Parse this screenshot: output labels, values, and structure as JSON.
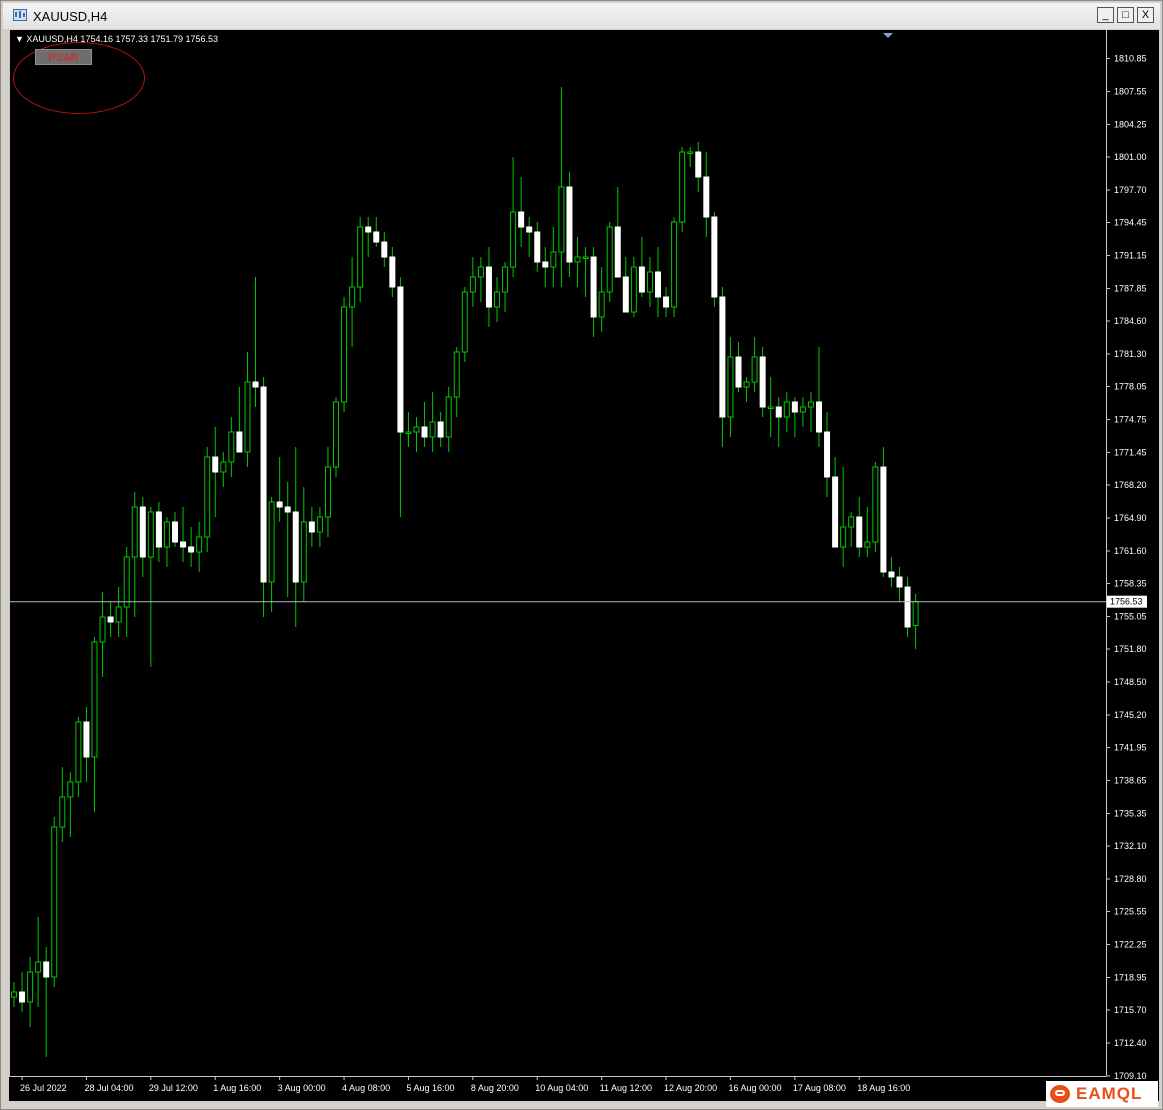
{
  "window": {
    "title": "XAUUSD,H4",
    "minimize_label": "_",
    "maximize_label": "□",
    "close_label": "X"
  },
  "chart_header": {
    "text": "XAUUSD,H4  1754.16 1757.33 1751.79 1756.53"
  },
  "indicator_button": {
    "label": "PSAR"
  },
  "watermark": {
    "text": "EAMQL"
  },
  "colors": {
    "background": "#000000",
    "bull_body": "#000000",
    "bull_outline": "#00c800",
    "bear_body": "#ffffff",
    "wick": "#00c800",
    "price_line": "#b4bcc8",
    "highlight_circle": "#b01818"
  },
  "chart_data": {
    "type": "candlestick",
    "symbol": "XAUUSD",
    "timeframe": "H4",
    "ylim": [
      1709.1,
      1812.5
    ],
    "current_price": 1756.53,
    "current_price_label": "1756.53",
    "yticks": [
      "1810.85",
      "1807.55",
      "1804.25",
      "1801.00",
      "1797.70",
      "1794.45",
      "1791.15",
      "1787.85",
      "1784.60",
      "1781.30",
      "1778.05",
      "1774.75",
      "1771.45",
      "1768.20",
      "1764.90",
      "1761.60",
      "1758.35",
      "1755.05",
      "1751.80",
      "1748.50",
      "1745.20",
      "1741.95",
      "1738.65",
      "1735.35",
      "1732.10",
      "1728.80",
      "1725.55",
      "1722.25",
      "1718.95",
      "1715.70",
      "1712.40",
      "1709.10"
    ],
    "xticks": [
      {
        "label": "26 Jul 2022",
        "index": 1
      },
      {
        "label": "28 Jul 04:00",
        "index": 9
      },
      {
        "label": "29 Jul 12:00",
        "index": 17
      },
      {
        "label": "1 Aug 16:00",
        "index": 25
      },
      {
        "label": "3 Aug 00:00",
        "index": 33
      },
      {
        "label": "4 Aug 08:00",
        "index": 41
      },
      {
        "label": "5 Aug 16:00",
        "index": 49
      },
      {
        "label": "8 Aug 20:00",
        "index": 57
      },
      {
        "label": "10 Aug 04:00",
        "index": 65
      },
      {
        "label": "11 Aug 12:00",
        "index": 73
      },
      {
        "label": "12 Aug 20:00",
        "index": 81
      },
      {
        "label": "16 Aug 00:00",
        "index": 89
      },
      {
        "label": "17 Aug 08:00",
        "index": 97
      },
      {
        "label": "18 Aug 16:00",
        "index": 105
      }
    ],
    "ohlc": [
      [
        1717.0,
        1718.5,
        1716.0,
        1717.5
      ],
      [
        1717.5,
        1719.5,
        1715.5,
        1716.5
      ],
      [
        1716.5,
        1721.0,
        1714.0,
        1719.5
      ],
      [
        1719.5,
        1725.0,
        1716.0,
        1720.5
      ],
      [
        1720.5,
        1722.0,
        1711.0,
        1719.0
      ],
      [
        1719.0,
        1735.0,
        1718.0,
        1734.0
      ],
      [
        1734.0,
        1740.0,
        1732.5,
        1737.0
      ],
      [
        1737.0,
        1739.5,
        1733.0,
        1738.5
      ],
      [
        1738.5,
        1745.0,
        1737.0,
        1744.5
      ],
      [
        1744.5,
        1746.0,
        1738.5,
        1741.0
      ],
      [
        1741.0,
        1753.0,
        1735.5,
        1752.5
      ],
      [
        1752.5,
        1757.5,
        1749.0,
        1755.0
      ],
      [
        1755.0,
        1756.5,
        1753.0,
        1754.5
      ],
      [
        1754.5,
        1758.0,
        1753.0,
        1756.0
      ],
      [
        1756.0,
        1762.0,
        1753.0,
        1761.0
      ],
      [
        1761.0,
        1767.5,
        1755.0,
        1766.0
      ],
      [
        1766.0,
        1767.0,
        1759.0,
        1761.0
      ],
      [
        1761.0,
        1766.0,
        1750.0,
        1765.5
      ],
      [
        1765.5,
        1766.5,
        1760.5,
        1762.0
      ],
      [
        1762.0,
        1765.0,
        1760.0,
        1764.5
      ],
      [
        1764.5,
        1765.5,
        1762.0,
        1762.5
      ],
      [
        1762.5,
        1766.0,
        1760.5,
        1762.0
      ],
      [
        1762.0,
        1764.0,
        1760.0,
        1761.5
      ],
      [
        1761.5,
        1764.5,
        1759.5,
        1763.0
      ],
      [
        1763.0,
        1772.0,
        1761.5,
        1771.0
      ],
      [
        1771.0,
        1774.0,
        1765.0,
        1769.5
      ],
      [
        1769.5,
        1771.5,
        1768.0,
        1770.5
      ],
      [
        1770.5,
        1775.0,
        1769.0,
        1773.5
      ],
      [
        1773.5,
        1778.0,
        1771.5,
        1771.5
      ],
      [
        1771.5,
        1781.5,
        1770.0,
        1778.5
      ],
      [
        1778.5,
        1789.0,
        1776.0,
        1778.0
      ],
      [
        1778.0,
        1779.0,
        1755.0,
        1758.5
      ],
      [
        1758.5,
        1767.0,
        1755.5,
        1766.5
      ],
      [
        1766.5,
        1771.0,
        1764.5,
        1766.0
      ],
      [
        1766.0,
        1768.5,
        1757.0,
        1765.5
      ],
      [
        1765.5,
        1772.0,
        1754.0,
        1758.5
      ],
      [
        1758.5,
        1768.0,
        1756.5,
        1764.5
      ],
      [
        1764.5,
        1766.0,
        1762.0,
        1763.5
      ],
      [
        1763.5,
        1766.0,
        1762.0,
        1765.0
      ],
      [
        1765.0,
        1772.0,
        1763.0,
        1770.0
      ],
      [
        1770.0,
        1777.0,
        1769.0,
        1776.5
      ],
      [
        1776.5,
        1787.0,
        1775.5,
        1786.0
      ],
      [
        1786.0,
        1791.0,
        1782.0,
        1788.0
      ],
      [
        1788.0,
        1795.0,
        1786.5,
        1794.0
      ],
      [
        1794.0,
        1795.0,
        1791.0,
        1793.5
      ],
      [
        1793.5,
        1795.0,
        1792.0,
        1792.5
      ],
      [
        1792.5,
        1793.5,
        1790.0,
        1791.0
      ],
      [
        1791.0,
        1792.0,
        1787.0,
        1788.0
      ],
      [
        1788.0,
        1789.0,
        1765.0,
        1773.5
      ],
      [
        1773.5,
        1775.5,
        1772.0,
        1773.5
      ],
      [
        1773.5,
        1775.0,
        1771.5,
        1774.0
      ],
      [
        1774.0,
        1776.5,
        1772.0,
        1773.0
      ],
      [
        1773.0,
        1777.5,
        1771.5,
        1774.5
      ],
      [
        1774.5,
        1775.5,
        1772.0,
        1773.0
      ],
      [
        1773.0,
        1778.0,
        1771.5,
        1777.0
      ],
      [
        1777.0,
        1782.0,
        1775.0,
        1781.5
      ],
      [
        1781.5,
        1788.0,
        1780.5,
        1787.5
      ],
      [
        1787.5,
        1791.0,
        1786.0,
        1789.0
      ],
      [
        1789.0,
        1791.0,
        1786.5,
        1790.0
      ],
      [
        1790.0,
        1792.0,
        1784.0,
        1786.0
      ],
      [
        1786.0,
        1789.0,
        1784.5,
        1787.5
      ],
      [
        1787.5,
        1790.5,
        1785.5,
        1790.0
      ],
      [
        1790.0,
        1801.0,
        1789.0,
        1795.5
      ],
      [
        1795.5,
        1799.0,
        1792.0,
        1794.0
      ],
      [
        1794.0,
        1795.0,
        1791.0,
        1793.5
      ],
      [
        1793.5,
        1794.5,
        1789.5,
        1790.5
      ],
      [
        1790.5,
        1792.0,
        1788.0,
        1790.0
      ],
      [
        1790.0,
        1794.0,
        1788.0,
        1791.5
      ],
      [
        1791.5,
        1808.0,
        1788.0,
        1798.0
      ],
      [
        1798.0,
        1799.5,
        1789.0,
        1790.5
      ],
      [
        1790.5,
        1793.0,
        1788.0,
        1791.0
      ],
      [
        1791.0,
        1792.0,
        1787.0,
        1791.0
      ],
      [
        1791.0,
        1792.0,
        1783.0,
        1785.0
      ],
      [
        1785.0,
        1790.0,
        1783.5,
        1787.5
      ],
      [
        1787.5,
        1794.5,
        1786.5,
        1794.0
      ],
      [
        1794.0,
        1798.0,
        1789.5,
        1789.0
      ],
      [
        1789.0,
        1791.0,
        1785.5,
        1785.5
      ],
      [
        1785.5,
        1791.0,
        1785.0,
        1790.0
      ],
      [
        1790.0,
        1793.0,
        1787.0,
        1787.5
      ],
      [
        1787.5,
        1791.0,
        1786.0,
        1789.5
      ],
      [
        1789.5,
        1792.0,
        1785.0,
        1787.0
      ],
      [
        1787.0,
        1788.0,
        1785.0,
        1786.0
      ],
      [
        1786.0,
        1795.0,
        1785.0,
        1794.5
      ],
      [
        1794.5,
        1802.0,
        1793.5,
        1801.5
      ],
      [
        1801.5,
        1802.0,
        1800.0,
        1801.5
      ],
      [
        1801.5,
        1802.5,
        1797.5,
        1799.0
      ],
      [
        1799.0,
        1801.5,
        1793.0,
        1795.0
      ],
      [
        1795.0,
        1795.5,
        1786.0,
        1787.0
      ],
      [
        1787.0,
        1788.0,
        1772.0,
        1775.0
      ],
      [
        1775.0,
        1783.0,
        1773.0,
        1781.0
      ],
      [
        1781.0,
        1782.5,
        1777.5,
        1778.0
      ],
      [
        1778.0,
        1779.0,
        1776.5,
        1778.5
      ],
      [
        1778.5,
        1783.0,
        1777.5,
        1781.0
      ],
      [
        1781.0,
        1782.0,
        1775.0,
        1776.0
      ],
      [
        1776.0,
        1779.0,
        1773.0,
        1776.0
      ],
      [
        1776.0,
        1777.0,
        1772.0,
        1775.0
      ],
      [
        1775.0,
        1777.5,
        1773.5,
        1776.5
      ],
      [
        1776.5,
        1777.0,
        1773.0,
        1775.5
      ],
      [
        1775.5,
        1777.0,
        1774.0,
        1776.0
      ],
      [
        1776.0,
        1777.5,
        1773.5,
        1776.5
      ],
      [
        1776.5,
        1782.0,
        1772.0,
        1773.5
      ],
      [
        1773.5,
        1775.5,
        1767.0,
        1769.0
      ],
      [
        1769.0,
        1771.0,
        1762.0,
        1762.0
      ],
      [
        1762.0,
        1770.0,
        1760.0,
        1764.0
      ],
      [
        1764.0,
        1765.5,
        1762.0,
        1765.0
      ],
      [
        1765.0,
        1767.0,
        1761.0,
        1762.0
      ],
      [
        1762.0,
        1766.0,
        1761.0,
        1762.5
      ],
      [
        1762.5,
        1770.5,
        1761.5,
        1770.0
      ],
      [
        1770.0,
        1772.0,
        1759.0,
        1759.5
      ],
      [
        1759.5,
        1761.0,
        1758.0,
        1759.0
      ],
      [
        1759.0,
        1760.0,
        1756.5,
        1758.0
      ],
      [
        1758.0,
        1759.0,
        1753.0,
        1754.0
      ],
      [
        1754.16,
        1757.33,
        1751.79,
        1756.53
      ]
    ]
  }
}
